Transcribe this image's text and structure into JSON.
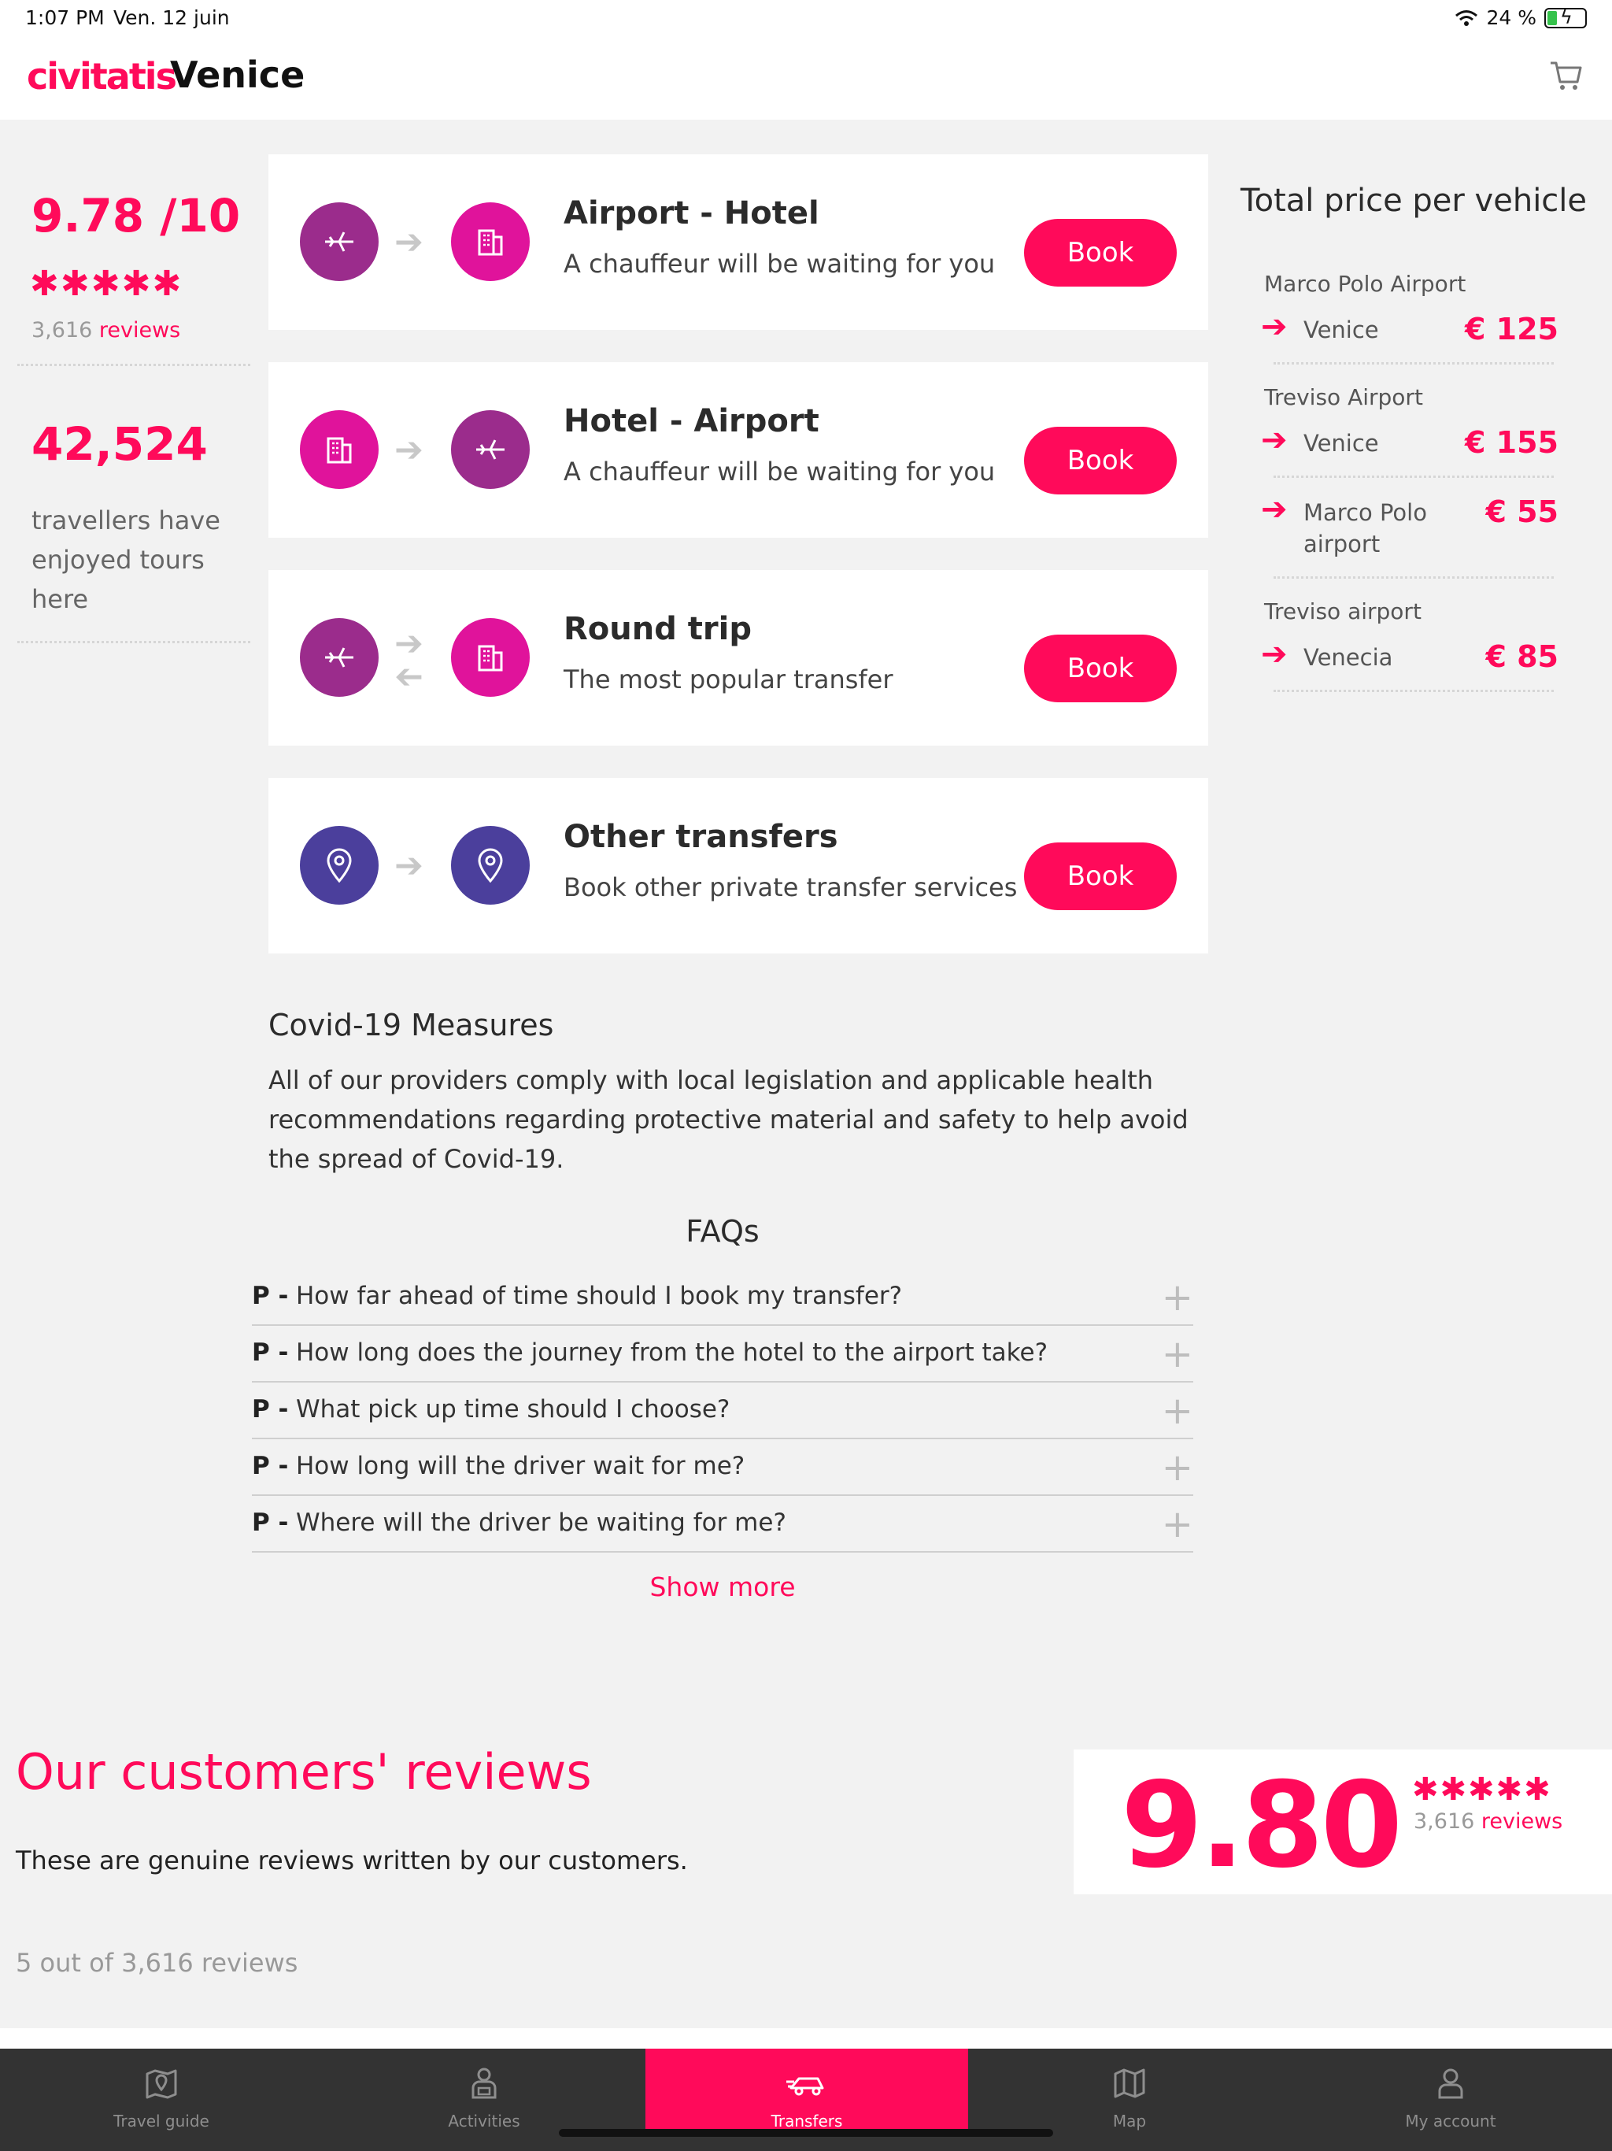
{
  "status": {
    "time": "1:07 PM",
    "date": "Ven. 12 juin",
    "battery": "24 %"
  },
  "header": {
    "logo": "civitatis",
    "city": "Venice",
    "cart_icon": "cart-icon"
  },
  "stats": {
    "rating": "9.78 /10",
    "stars": "✱✱✱✱✱",
    "reviews_count": "3,616",
    "reviews_label": "reviews",
    "travellers": "42,524",
    "travellers_text": "travellers have enjoyed tours here"
  },
  "transfers": [
    {
      "title": "Airport - Hotel",
      "subtitle": "A chauffeur will be waiting for you",
      "button": "Book",
      "from_icon": "plane-icon",
      "to_icon": "hotel-icon"
    },
    {
      "title": "Hotel - Airport",
      "subtitle": "A chauffeur will be waiting for you",
      "button": "Book",
      "from_icon": "hotel-icon",
      "to_icon": "plane-icon"
    },
    {
      "title": "Round trip",
      "subtitle": "The most popular transfer",
      "button": "Book",
      "from_icon": "plane-icon",
      "to_icon": "hotel-icon"
    },
    {
      "title": "Other transfers",
      "subtitle": "Book other private transfer services",
      "button": "Book",
      "from_icon": "location-pin-icon",
      "to_icon": "location-pin-icon"
    }
  ],
  "prices": {
    "title": "Total price per vehicle",
    "groups": [
      {
        "origin": "Marco Polo Airport",
        "routes": [
          {
            "dest": "Venice",
            "price": "€ 125"
          }
        ]
      },
      {
        "origin": "Treviso Airport",
        "routes": [
          {
            "dest": "Venice",
            "price": "€ 155"
          },
          {
            "dest_line1": "Marco Polo",
            "dest_line2": "airport",
            "price": "€ 55"
          }
        ]
      },
      {
        "origin": "Treviso airport",
        "routes": [
          {
            "dest": "Venecia",
            "price": "€ 85"
          }
        ]
      }
    ]
  },
  "covid": {
    "title": "Covid-19 Measures",
    "text": "All of our providers comply with local legislation and applicable health recommendations regarding protective material and safety to help avoid the spread of Covid-19."
  },
  "faq": {
    "title": "FAQs",
    "prefix": "P -",
    "items": [
      "How far ahead of time should I book my transfer?",
      "How long does the journey from the hotel to the airport take?",
      "What pick up time should I choose?",
      "How long will the driver wait for me?",
      "Where will the driver be waiting for me?"
    ],
    "show_more": "Show more"
  },
  "reviews": {
    "title": "Our customers' reviews",
    "subtitle": "These are genuine reviews written by our customers.",
    "count_text": "5 out of 3,616 reviews",
    "score": "9.80",
    "stars": "✱✱✱✱✱",
    "count": "3,616",
    "label": "reviews"
  },
  "tabs": [
    {
      "label": "Travel guide",
      "icon": "map-pin-book-icon"
    },
    {
      "label": "Activities",
      "icon": "person-ticket-icon"
    },
    {
      "label": "Transfers",
      "icon": "car-icon",
      "active": true
    },
    {
      "label": "Map",
      "icon": "map-icon"
    },
    {
      "label": "My account",
      "icon": "user-icon"
    }
  ],
  "colors": {
    "accent": "#ff0a5a",
    "purple": "#9b2c8c",
    "magenta": "#e0139b",
    "indigo": "#4b3f9c",
    "tabbar": "#333333"
  }
}
